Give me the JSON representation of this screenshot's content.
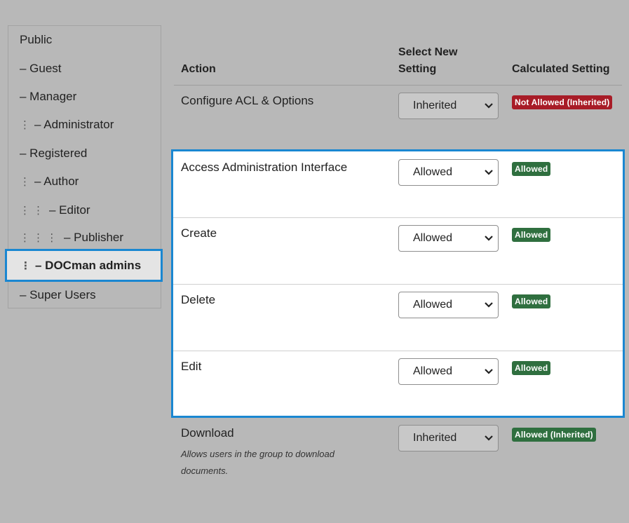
{
  "sidebar": {
    "groups": [
      {
        "label": "Public"
      },
      {
        "label": "– Guest"
      },
      {
        "label": "– Manager"
      },
      {
        "label": "– Administrator",
        "dots": "⋮"
      },
      {
        "label": "– Registered"
      },
      {
        "label": "– Author",
        "dots": "⋮"
      },
      {
        "label": "– Editor",
        "dots": "⋮  ⋮"
      },
      {
        "label": "– Publisher",
        "dots": "⋮  ⋮  ⋮"
      },
      {
        "label": "– DOCman admins",
        "dots": "⋮",
        "active": true
      },
      {
        "label": "– Super Users"
      }
    ]
  },
  "table": {
    "headers": {
      "action": "Action",
      "select_line1": "Select New",
      "select_line2": "Setting",
      "calculated": "Calculated Setting"
    },
    "rows": [
      {
        "action": "Configure ACL & Options",
        "select": "Inherited",
        "badge": "Not Allowed (Inherited)",
        "badge_status": "denied"
      },
      {
        "action": "Access Administration Interface",
        "select": "Allowed",
        "badge": "Allowed",
        "badge_status": "allowed"
      },
      {
        "action": "Create",
        "select": "Allowed",
        "badge": "Allowed",
        "badge_status": "allowed"
      },
      {
        "action": "Delete",
        "select": "Allowed",
        "badge": "Allowed",
        "badge_status": "allowed"
      },
      {
        "action": "Edit",
        "select": "Allowed",
        "badge": "Allowed",
        "badge_status": "allowed"
      },
      {
        "action": "Download",
        "description_line1": "Allows users in the group to download",
        "description_line2": "documents.",
        "select": "Inherited",
        "badge": "Allowed (Inherited)",
        "badge_status": "allowed"
      }
    ]
  },
  "colors": {
    "highlight_border": "#1a87d1",
    "allowed": "#2f6f3f",
    "denied": "#a81c27"
  },
  "icons": {
    "select_chevron": "chevron-down-icon",
    "indent": "vertical-dots-icon"
  }
}
